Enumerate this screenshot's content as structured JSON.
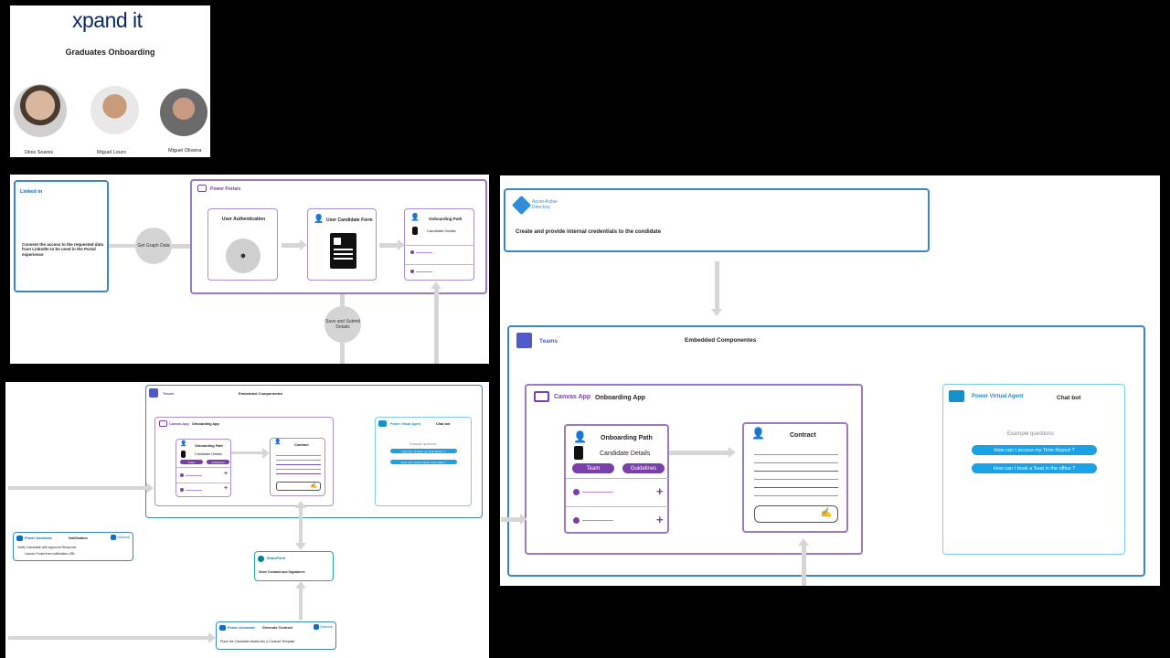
{
  "cover": {
    "logo": "xpand it",
    "title": "Graduates Onboarding",
    "people": [
      "Dinis Soares",
      "Miguel Louro",
      "Miguel Oliveira"
    ]
  },
  "flow1": {
    "linkedin_logo": "Linked in",
    "linkedin_text": "Consent the access to the requested data from LinkedIn to be used in the Portal experience",
    "graph_label": "Get Graph Data",
    "portal_label": "Power Portals",
    "auth_label": "User Authentication",
    "form_label": "User Candidate Form",
    "path_title": "Onboarding Path",
    "path_item": "Candidate Details",
    "submit_label": "Save and Submit Details"
  },
  "right": {
    "azure_name": "Azure Active Directory",
    "azure_text": "Create and provide internal credentials to the condidate",
    "teams_label": "Teams",
    "embedded_label": "Embedded Componentes",
    "canvas_label": "Canvas App",
    "onboarding_app": "Onboarding App",
    "path_title": "Onboarding Path",
    "path_item": "Candidate Details",
    "team_btn": "Team",
    "guidelines_btn": "Guidelines",
    "contract_title": "Contract",
    "pva_label": "Power Virtual Agent",
    "chatbot_label": "Chat bot",
    "examples_label": "Example questions",
    "q1": "How can I access my Time Report ?",
    "q2": "How can I book a Seat in the office ?"
  },
  "bottom": {
    "teams_label": "Teams",
    "embedded_label": "Embedded Componentes",
    "canvas_label": "Canvas App",
    "onboarding_app": "Onboarding App",
    "path_title": "Onboarding Path",
    "path_item": "Candidate Details",
    "team_btn": "Team",
    "guidelines_btn": "Guidelines",
    "contract_title": "Contract",
    "pva_label": "Power Virtual Agent",
    "chatbot_label": "Chat bot",
    "examples_label": "Example questions",
    "q1": "How can I access my Time Report ?",
    "q2": "How can I book a Seat in the office ?",
    "notif_label": "Power Automate",
    "notif_title": "Notification",
    "outlook": "Outlook",
    "notif_line1": "Notify Candidate with Approval Response",
    "notif_line2": "Launch Portal from notification URL",
    "sharepoint_label": "SharePoint",
    "sharepoint_text": "Store Contract and Signatures",
    "gen_label": "Power Automate",
    "gen_title": "Generate Contract",
    "gen_text": "Place the Candidate details into a Contract Template"
  },
  "colors": {
    "purple": "#7a3fa8",
    "blue": "#3a86c8",
    "cyan": "#19a3e6",
    "teal": "#2aa7a0"
  }
}
